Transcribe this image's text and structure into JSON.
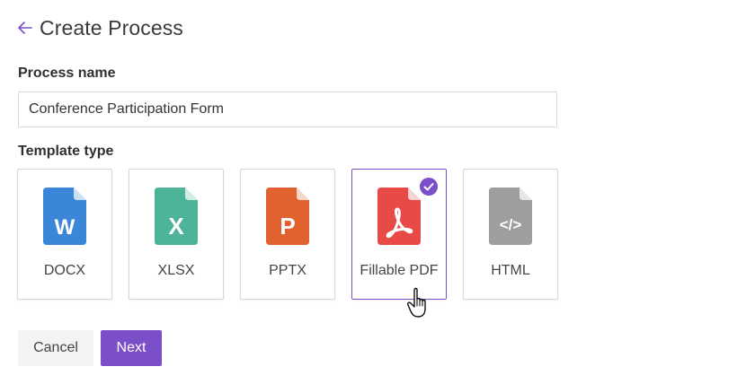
{
  "header": {
    "title": "Create Process",
    "back_icon": "arrow-left-icon"
  },
  "process_name": {
    "label": "Process name",
    "value": "Conference Participation Form"
  },
  "template_type": {
    "label": "Template type",
    "selected": "Fillable PDF",
    "options": [
      {
        "label": "DOCX",
        "icon": "word-file-icon",
        "glyph": "W",
        "color": "#3b86d8"
      },
      {
        "label": "XLSX",
        "icon": "excel-file-icon",
        "glyph": "X",
        "color": "#4db49a"
      },
      {
        "label": "PPTX",
        "icon": "powerpoint-file-icon",
        "glyph": "P",
        "color": "#e0622e"
      },
      {
        "label": "Fillable PDF",
        "icon": "pdf-file-icon",
        "glyph": "",
        "color": "#e84b47"
      },
      {
        "label": "HTML",
        "icon": "html-file-icon",
        "glyph": "</>",
        "color": "#9e9e9e"
      }
    ]
  },
  "actions": {
    "cancel_label": "Cancel",
    "next_label": "Next"
  },
  "colors": {
    "accent": "#7b4fc9",
    "selected_border": "#7b4fc9"
  }
}
